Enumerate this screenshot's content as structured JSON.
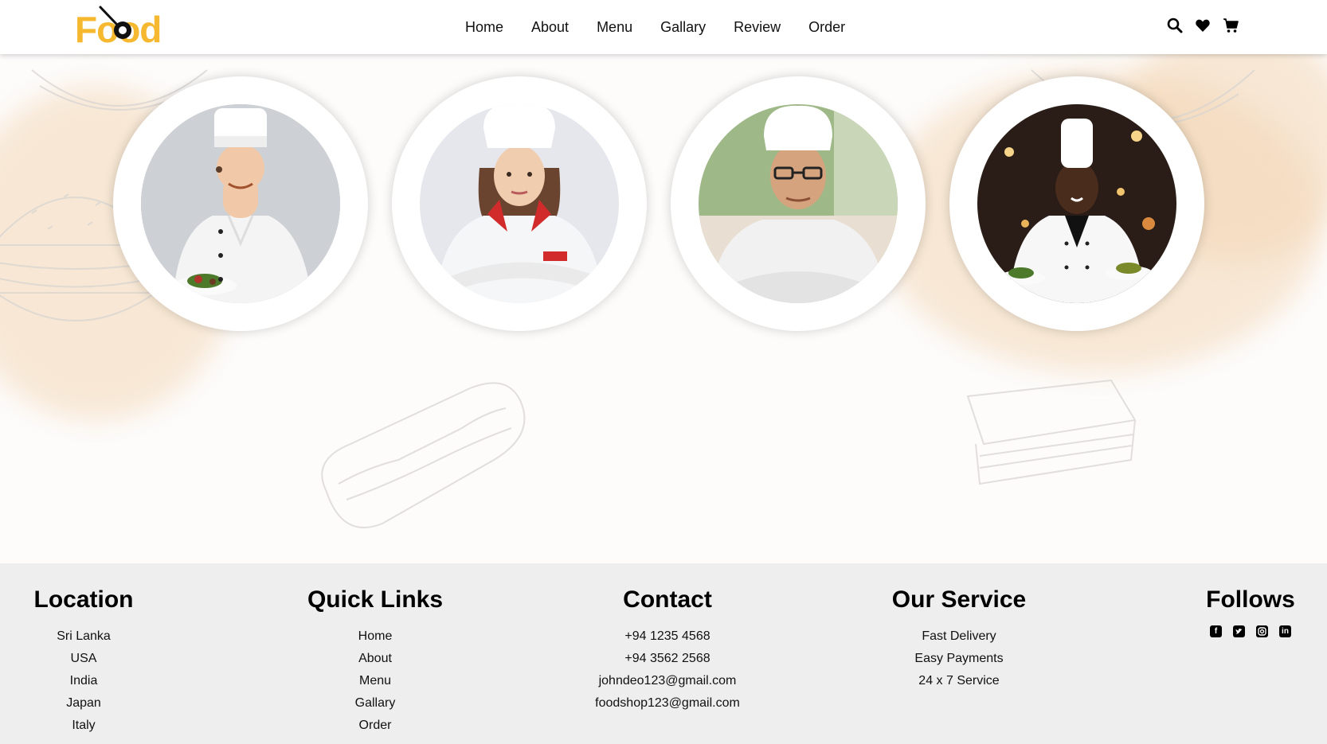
{
  "brand": {
    "logo_text": "Food",
    "accent_color": "#f5b82e"
  },
  "nav": {
    "items": [
      {
        "label": "Home"
      },
      {
        "label": "About"
      },
      {
        "label": "Menu"
      },
      {
        "label": "Gallary"
      },
      {
        "label": "Review"
      },
      {
        "label": "Order"
      }
    ]
  },
  "header_icons": [
    "search-icon",
    "heart-icon",
    "cart-icon"
  ],
  "chefs": [
    {
      "photo": "chef-man-holding-salad-plate"
    },
    {
      "photo": "chef-woman-arms-crossed"
    },
    {
      "photo": "chef-man-glasses-arms-crossed"
    },
    {
      "photo": "chef-man-holding-two-plates"
    }
  ],
  "footer": {
    "location": {
      "title": "Location",
      "items": [
        "Sri Lanka",
        "USA",
        "India",
        "Japan",
        "Italy"
      ]
    },
    "quick_links": {
      "title": "Quick Links",
      "items": [
        "Home",
        "About",
        "Menu",
        "Gallary",
        "Order"
      ]
    },
    "contact": {
      "title": "Contact",
      "items": [
        "+94 1235 4568",
        "+94 3562 2568",
        "johndeo123@gmail.com",
        "foodshop123@gmail.com"
      ]
    },
    "service": {
      "title": "Our Service",
      "items": [
        "Fast Delivery",
        "Easy Payments",
        "24 x 7 Service"
      ]
    },
    "follows": {
      "title": "Follows",
      "icons": [
        "facebook-icon",
        "twitter-icon",
        "instagram-icon",
        "linkedin-icon"
      ]
    }
  }
}
